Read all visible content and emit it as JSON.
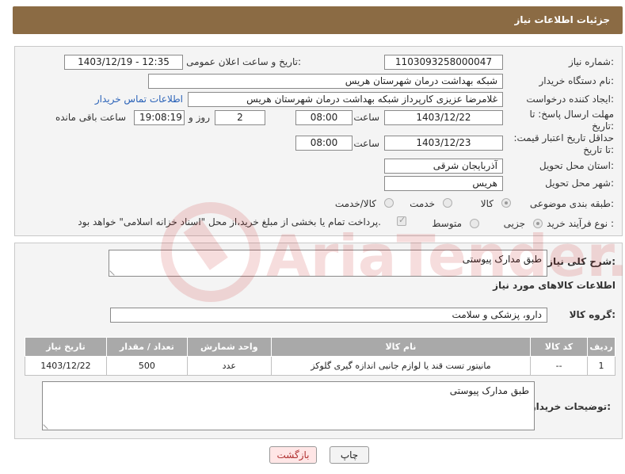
{
  "header": {
    "title": "جزئیات اطلاعات نیاز"
  },
  "form": {
    "need_number_label": "شماره نیاز:",
    "need_number": "1103093258000047",
    "announce_label": "تاریخ و ساعت اعلان عمومی:",
    "announce_value": "1403/12/19 - 12:35",
    "buyer_org_label": "نام دستگاه خریدار:",
    "buyer_org": "شبکه بهداشت درمان شهرستان هریس",
    "creator_label": "ایجاد کننده درخواست:",
    "creator": "غلامرضا عزیزی کارپرداز شبکه بهداشت درمان شهرستان هریس",
    "contact_link": "اطلاعات تماس خریدار",
    "reply_deadline_label": "مهلت ارسال پاسخ: تا تاریخ:",
    "reply_date": "1403/12/22",
    "time_label": "ساعت",
    "reply_time": "08:00",
    "days_value": "2",
    "days_label": "روز و",
    "remaining_time": "19:08:19",
    "remaining_label": "ساعت باقی مانده",
    "validity_label": "حداقل تاریخ اعتبار قیمت: تا تاریخ:",
    "validity_date": "1403/12/23",
    "validity_time": "08:00",
    "province_label": "استان محل تحویل:",
    "province": "آذربایجان شرقی",
    "city_label": "شهر محل تحویل:",
    "city": "هریس",
    "category_label": "طبقه بندی موضوعی:",
    "category_options": [
      "کالا",
      "خدمت",
      "کالا/خدمت"
    ],
    "category_selected": "کالا",
    "purchase_label": "نوع فرآیند خرید :",
    "purchase_options": [
      "جزیی",
      "متوسط"
    ],
    "purchase_selected": "جزیی",
    "payment_note": "پرداخت تمام یا بخشی از مبلغ خرید،از محل \"اسناد خزانه اسلامی\" خواهد بود."
  },
  "details": {
    "summary_label": "شرح کلی نیاز:",
    "summary": "طبق مدارک پیوستی",
    "goods_info_title": "اطلاعات کالاهای مورد نیاز",
    "goods_group_label": "گروه کالا:",
    "goods_group": "دارو، پزشکی و سلامت"
  },
  "table": {
    "headers": [
      "ردیف",
      "کد کالا",
      "نام کالا",
      "واحد شمارش",
      "تعداد / مقدار",
      "تاریخ نیاز"
    ],
    "rows": [
      [
        "1",
        "--",
        "مانیتور تست قند یا لوازم جانبی اندازه گیری گلوکز",
        "عدد",
        "500",
        "1403/12/22"
      ]
    ]
  },
  "buyer_notes": {
    "label": "توضیحات خریدار:",
    "text": "طبق مدارک پیوستی"
  },
  "buttons": {
    "print": "چاپ",
    "back": "بازگشت"
  },
  "watermark": {
    "text": "AriaTender.neT"
  },
  "colors": {
    "header": "#8b6b44",
    "table_header": "#a9a9a9",
    "link": "#2a62b8",
    "back_button_bg": "#ffe6e6"
  }
}
